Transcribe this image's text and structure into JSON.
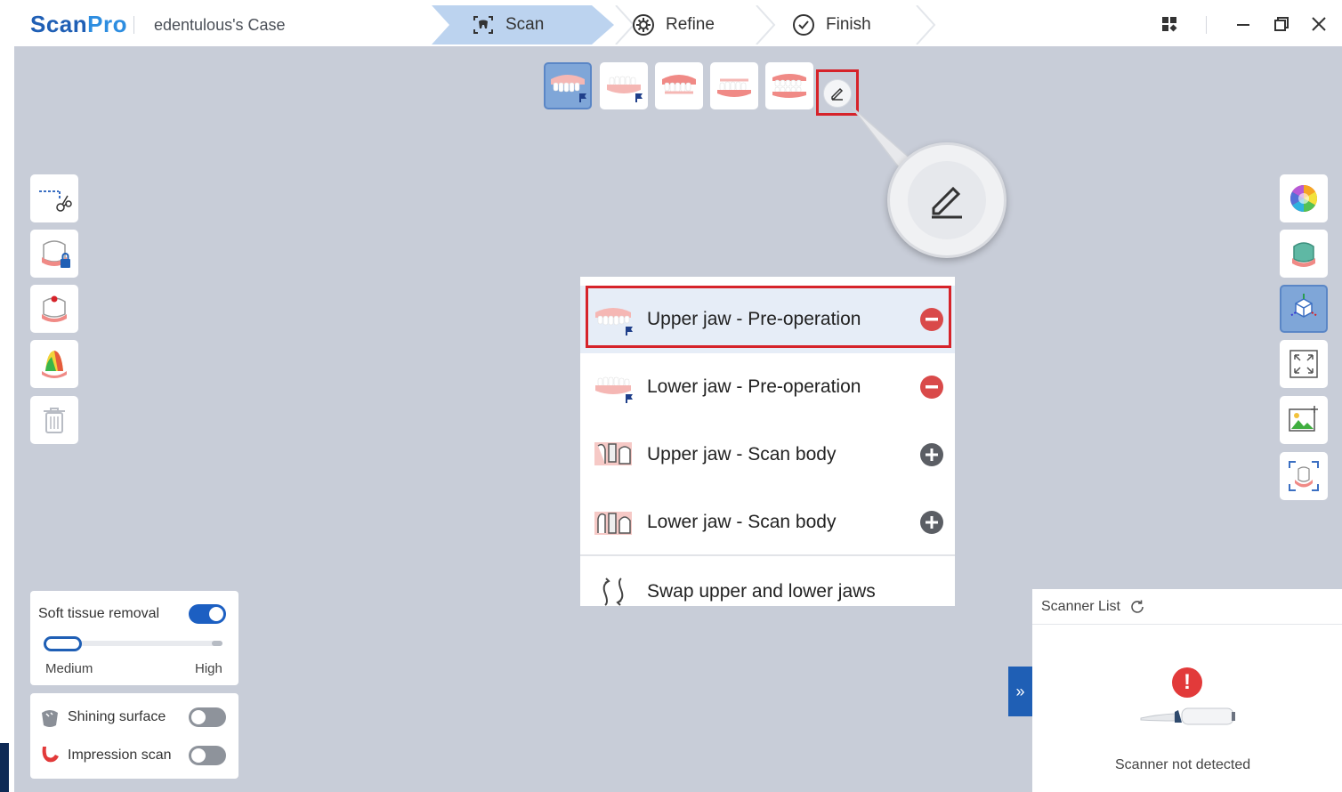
{
  "app": {
    "logo_part1": "Scan",
    "logo_part2": "Pro",
    "case_title": "edentulous's Case"
  },
  "steps": [
    {
      "label": "Scan",
      "icon": "scan-icon",
      "active": true
    },
    {
      "label": "Refine",
      "icon": "gear-icon",
      "active": false
    },
    {
      "label": "Finish",
      "icon": "check-circle-icon",
      "active": false
    }
  ],
  "window_controls": [
    "apps-grid-icon",
    "minimize-icon",
    "restore-icon",
    "close-icon"
  ],
  "stage_tabs": [
    {
      "icon": "upper-jaw-flag-icon",
      "active": true
    },
    {
      "icon": "lower-jaw-flag-icon",
      "active": false
    },
    {
      "icon": "upper-jaw-icon",
      "active": false
    },
    {
      "icon": "lower-jaw-icon",
      "active": false
    },
    {
      "icon": "bite-icon",
      "active": false
    }
  ],
  "menu": {
    "items": [
      {
        "label": "Upper jaw - Pre-operation",
        "action": "remove",
        "highlighted": true
      },
      {
        "label": "Lower jaw - Pre-operation",
        "action": "remove",
        "highlighted": false
      },
      {
        "label": "Upper jaw - Scan body",
        "action": "add",
        "highlighted": false
      },
      {
        "label": "Lower jaw - Scan body",
        "action": "add",
        "highlighted": false
      }
    ],
    "swap_label": "Swap upper and lower jaws"
  },
  "left_tools": [
    "cut-icon",
    "lock-tooth-icon",
    "marker-tooth-icon",
    "color-tooth-icon",
    "trash-icon"
  ],
  "right_tools": [
    "color-wheel-icon",
    "model-icon",
    "view-cube-icon",
    "fit-screen-icon",
    "image-icon",
    "capture-icon"
  ],
  "soft_tissue": {
    "label": "Soft tissue removal",
    "enabled": true,
    "level_low": "Medium",
    "level_high": "High",
    "level": 0
  },
  "options": [
    {
      "label": "Shining surface",
      "enabled": false,
      "icon": "shining-tooth-icon"
    },
    {
      "label": "Impression scan",
      "enabled": false,
      "icon": "impression-icon"
    }
  ],
  "scanner_list": {
    "title": "Scanner List",
    "status": "Scanner not detected",
    "expand_label": "»"
  },
  "colors": {
    "accent": "#1f5fb5",
    "active_step": "#bcd3ef",
    "canvas": "#c8cdd8",
    "highlight_box": "#d6232a",
    "remove": "#d94a4a"
  }
}
